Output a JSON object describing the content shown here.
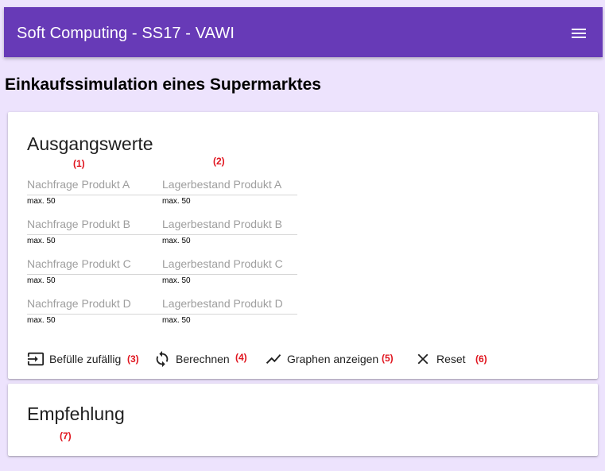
{
  "toolbar": {
    "title": "Soft Computing - SS17 - VAWI",
    "menu_icon": "menu-icon"
  },
  "page_title": "Einkaufssimulation eines Supermarktes",
  "ausgangswerte": {
    "title": "Ausgangswerte",
    "nachfrage_fields": [
      {
        "placeholder": "Nachfrage Produkt A",
        "hint": "max. 50"
      },
      {
        "placeholder": "Nachfrage Produkt B",
        "hint": "max. 50"
      },
      {
        "placeholder": "Nachfrage Produkt C",
        "hint": "max. 50"
      },
      {
        "placeholder": "Nachfrage Produkt D",
        "hint": "max. 50"
      }
    ],
    "lager_fields": [
      {
        "placeholder": "Lagerbestand Produkt A",
        "hint": "max. 50"
      },
      {
        "placeholder": "Lagerbestand Produkt B",
        "hint": "max. 50"
      },
      {
        "placeholder": "Lagerbestand Produkt C",
        "hint": "max. 50"
      },
      {
        "placeholder": "Lagerbestand Produkt D",
        "hint": "max. 50"
      }
    ],
    "actions": {
      "fill_random": "Befülle zufällig",
      "calculate": "Berechnen",
      "show_graphs": "Graphen anzeigen",
      "reset": "Reset"
    }
  },
  "empfehlung": {
    "title": "Empfehlung"
  },
  "annotations": [
    "(1)",
    "(2)",
    "(3)",
    "(4)",
    "(5)",
    "(6)",
    "(7)"
  ],
  "colors": {
    "toolbar": "#673ab7",
    "background": "#ede3fd",
    "marker": "#e0141e"
  }
}
